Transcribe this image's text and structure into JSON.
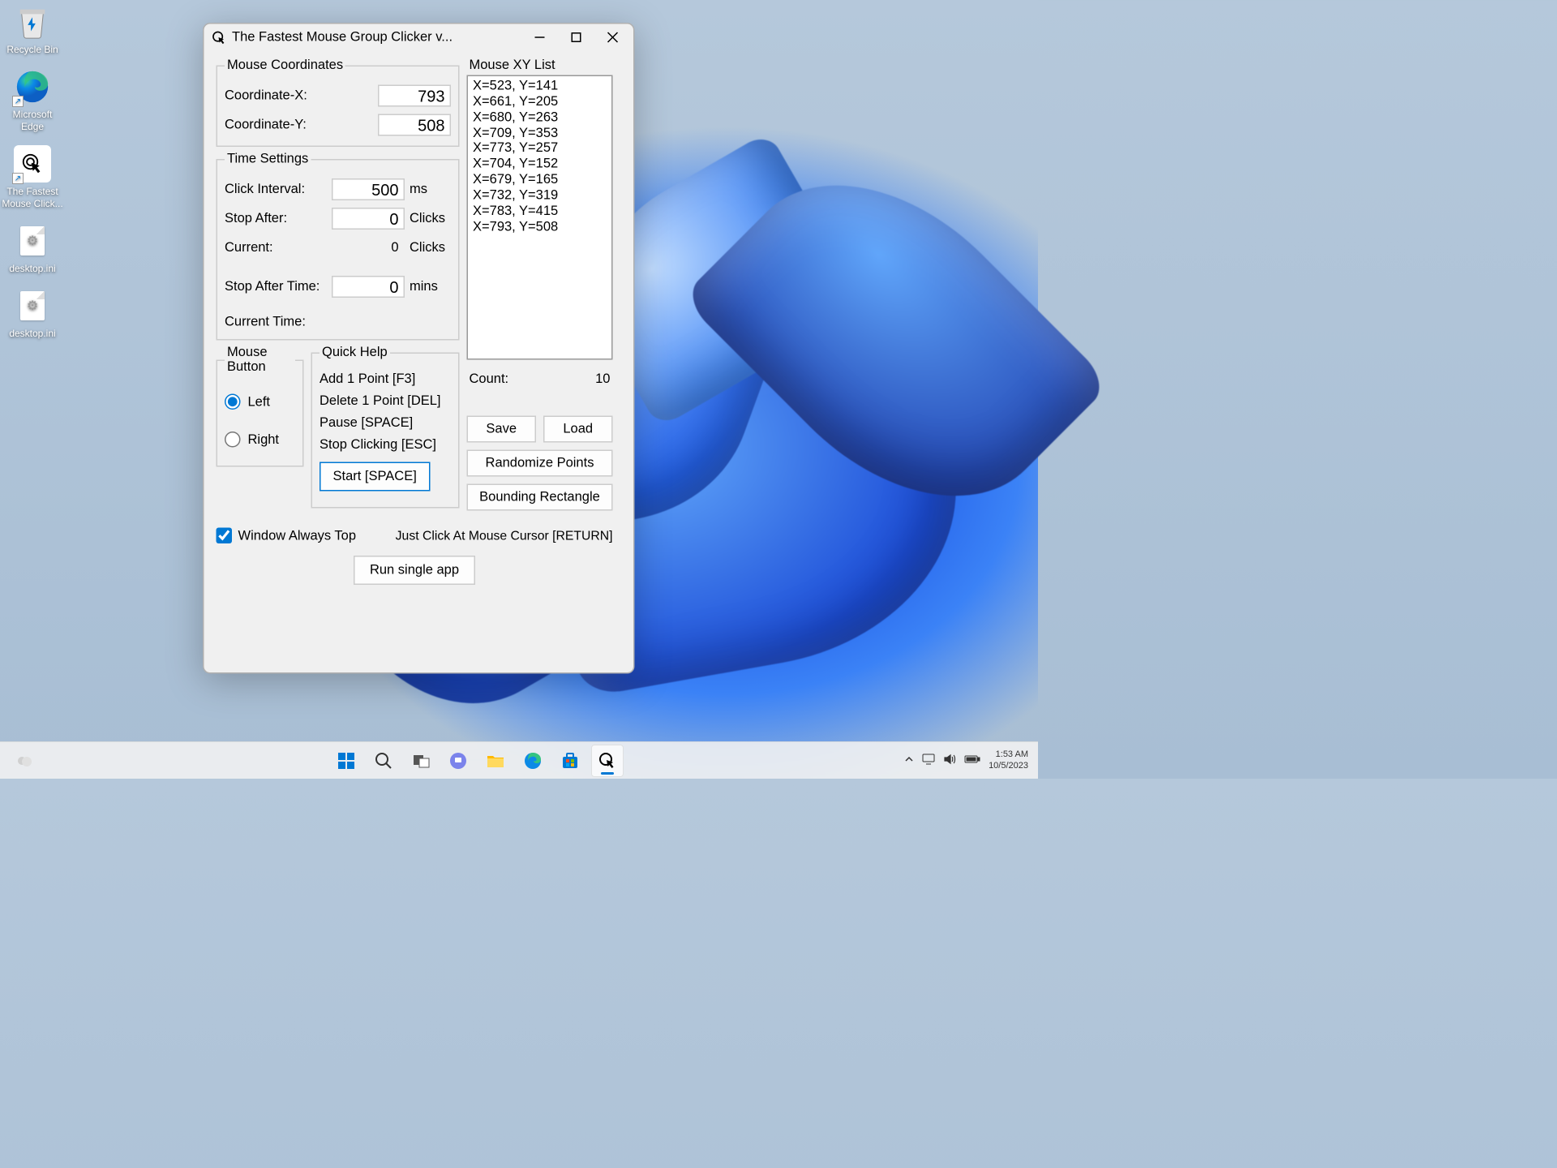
{
  "desktop": {
    "icons": [
      {
        "label": "Recycle Bin",
        "type": "recycle"
      },
      {
        "label": "Microsoft Edge",
        "type": "edge"
      },
      {
        "label": "The Fastest Mouse Click...",
        "type": "clicker"
      },
      {
        "label": "desktop.ini",
        "type": "ini"
      },
      {
        "label": "desktop.ini",
        "type": "ini"
      }
    ]
  },
  "window": {
    "title": "The Fastest Mouse Group Clicker v...",
    "coords": {
      "legend": "Mouse Coordinates",
      "x_label": "Coordinate-X:",
      "x_value": "793",
      "y_label": "Coordinate-Y:",
      "y_value": "508"
    },
    "time": {
      "legend": "Time Settings",
      "interval_label": "Click Interval:",
      "interval_value": "500",
      "interval_unit": "ms",
      "stop_after_label": "Stop After:",
      "stop_after_value": "0",
      "stop_after_unit": "Clicks",
      "current_label": "Current:",
      "current_value": "0",
      "current_unit": "Clicks",
      "stop_time_label": "Stop After Time:",
      "stop_time_value": "0",
      "stop_time_unit": "mins",
      "current_time_label": "Current Time:"
    },
    "mouse_button": {
      "legend": "Mouse Button",
      "left": "Left",
      "right": "Right"
    },
    "help": {
      "legend": "Quick Help",
      "lines": [
        "Add 1 Point [F3]",
        "Delete 1 Point [DEL]",
        "Pause [SPACE]",
        "Stop Clicking [ESC]"
      ],
      "start": "Start [SPACE]"
    },
    "xylist": {
      "legend": "Mouse XY List",
      "items": [
        "X=523, Y=141",
        "X=661, Y=205",
        "X=680, Y=263",
        "X=709, Y=353",
        "X=773, Y=257",
        "X=704, Y=152",
        "X=679, Y=165",
        "X=732, Y=319",
        "X=783, Y=415",
        "X=793, Y=508"
      ],
      "count_label": "Count:",
      "count_value": "10"
    },
    "buttons": {
      "save": "Save",
      "load": "Load",
      "randomize": "Randomize Points",
      "bounding": "Bounding Rectangle"
    },
    "always_top": "Window Always Top",
    "cursor_hint": "Just Click At Mouse Cursor [RETURN]",
    "run_single": "Run single app"
  },
  "taskbar": {
    "time": "1:53 AM",
    "date": "10/5/2023"
  }
}
